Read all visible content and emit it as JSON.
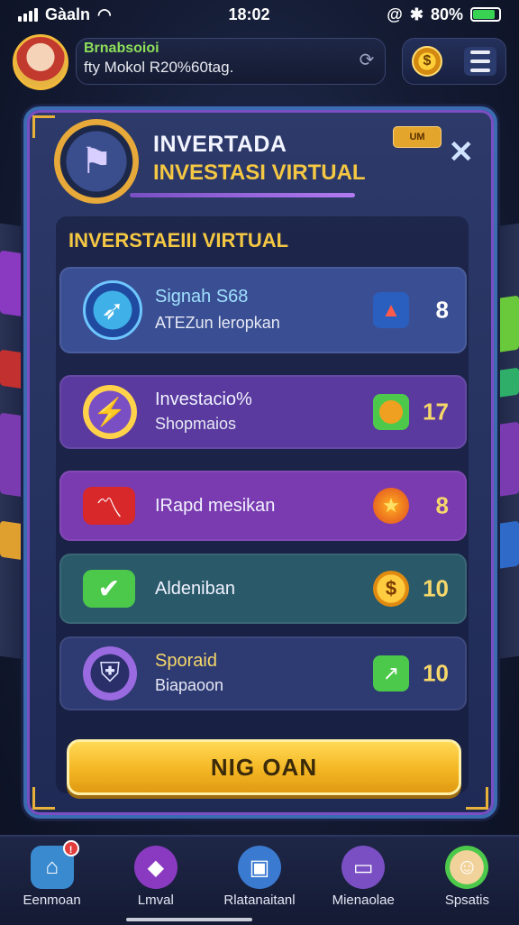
{
  "status": {
    "carrier": "Gàaln",
    "time": "18:02",
    "battery": "80%",
    "battery_level": 0.8
  },
  "header": {
    "username": "Brnabsoioi",
    "subtitle": "fty Mokol R20%60tag.",
    "coin_symbol": "$"
  },
  "panel": {
    "title": "INVERTADA",
    "subtitle": "INVESTASI VIRTUAL",
    "tag": "UM",
    "section_title": "INVERSTAEIII VIRTUAL",
    "items": [
      {
        "line1": "Signah S68",
        "line2": "ATEZun leropkan",
        "value": "8",
        "icon": "compass-icon",
        "right_icon": "chart-up-icon",
        "color": "#3a4f93"
      },
      {
        "line1": "Investacio%",
        "line2": "Shopmaios",
        "value": "17",
        "icon": "lightning-icon",
        "right_icon": "coin-icon",
        "color": "#5a3a9e"
      },
      {
        "line1": "IRapd mesikan",
        "line2": "",
        "value": "8",
        "icon": "trend-icon",
        "right_icon": "star-icon",
        "color": "#7a3ab0"
      },
      {
        "line1": "Aldeniban",
        "line2": "",
        "value": "10",
        "icon": "check-icon",
        "right_icon": "coin-icon",
        "color": "#2a5a6a"
      },
      {
        "line1": "Sporaid",
        "line2": "Biapaoon",
        "value": "10",
        "icon": "shield-icon",
        "right_icon": "chart-up-icon",
        "color": "#2e3a72"
      }
    ],
    "cta_label": "NIG OAN"
  },
  "nav": [
    {
      "label": "Eenmoan",
      "icon": "house-icon",
      "badge": ""
    },
    {
      "label": "Lmval",
      "icon": "gem-icon",
      "badge": ""
    },
    {
      "label": "Rlatanaitanl",
      "icon": "box-icon",
      "badge": ""
    },
    {
      "label": "Mienaolae",
      "icon": "screen-icon",
      "badge": ""
    },
    {
      "label": "Spsatis",
      "icon": "face-icon",
      "badge": ""
    }
  ]
}
